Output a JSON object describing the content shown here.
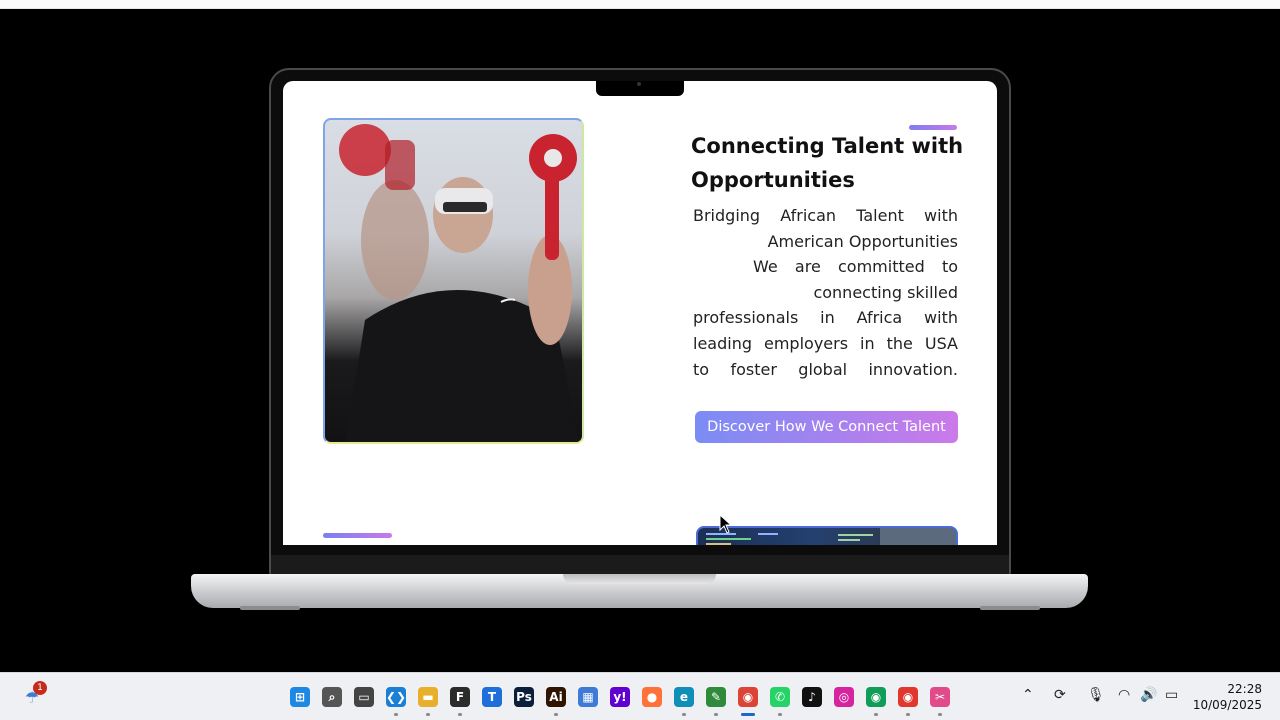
{
  "screen": {
    "heading": "Connecting Talent with Opportunities",
    "paragraph_lines": [
      "Bridging African Talent with",
      "American Opportunities",
      "We are committed to",
      "connecting skilled",
      "professionals in Africa with",
      "leading employers in the USA",
      "to foster global innovation."
    ],
    "cta_label": "Discover How We Connect Talent",
    "accent_start": "#7b8cf5",
    "accent_end": "#cc79e9"
  },
  "taskbar": {
    "weather_badge": "1",
    "apps": [
      {
        "name": "start-icon",
        "glyph": "⊞",
        "bg": "#1e88e5",
        "running": false
      },
      {
        "name": "search-icon",
        "glyph": "⌕",
        "bg": "#555555",
        "running": false
      },
      {
        "name": "task-view-icon",
        "glyph": "▭",
        "bg": "#444444",
        "running": false
      },
      {
        "name": "vscode-icon",
        "glyph": "❮❯",
        "bg": "#1c7fd6",
        "running": true
      },
      {
        "name": "file-explorer-icon",
        "glyph": "▬",
        "bg": "#e8b02a",
        "running": true
      },
      {
        "name": "figma-icon",
        "glyph": "F",
        "bg": "#2b2b2b",
        "running": true
      },
      {
        "name": "trello-icon",
        "glyph": "T",
        "bg": "#1e6fd9",
        "running": false
      },
      {
        "name": "photoshop-icon",
        "glyph": "Ps",
        "bg": "#0b1f3a",
        "running": false
      },
      {
        "name": "illustrator-icon",
        "glyph": "Ai",
        "bg": "#2f1500",
        "running": true
      },
      {
        "name": "store-icon",
        "glyph": "▦",
        "bg": "#3d7bd6",
        "running": false
      },
      {
        "name": "yahoo-icon",
        "glyph": "y!",
        "bg": "#6001d2",
        "running": false
      },
      {
        "name": "firefox-icon",
        "glyph": "●",
        "bg": "#ff7139",
        "running": false
      },
      {
        "name": "edge-icon",
        "glyph": "e",
        "bg": "#0f8fb8",
        "running": true
      },
      {
        "name": "sticky-notes-icon",
        "glyph": "✎",
        "bg": "#2f8a3a",
        "running": true
      },
      {
        "name": "chrome-icon",
        "glyph": "◉",
        "bg": "#db4437",
        "running": true,
        "active": true
      },
      {
        "name": "whatsapp-icon",
        "glyph": "✆",
        "bg": "#25d366",
        "running": true
      },
      {
        "name": "tiktok-icon",
        "glyph": "♪",
        "bg": "#111111",
        "running": false
      },
      {
        "name": "instagram-icon",
        "glyph": "◎",
        "bg": "#d6249f",
        "running": false
      },
      {
        "name": "chrome-profile-icon",
        "glyph": "◉",
        "bg": "#0f9d58",
        "running": true
      },
      {
        "name": "chrome-profile-2-icon",
        "glyph": "◉",
        "bg": "#e0382e",
        "running": true
      },
      {
        "name": "snipping-tool-icon",
        "glyph": "✂",
        "bg": "#e14b8a",
        "running": true
      }
    ],
    "time": "22:28",
    "date": "10/09/2025"
  }
}
